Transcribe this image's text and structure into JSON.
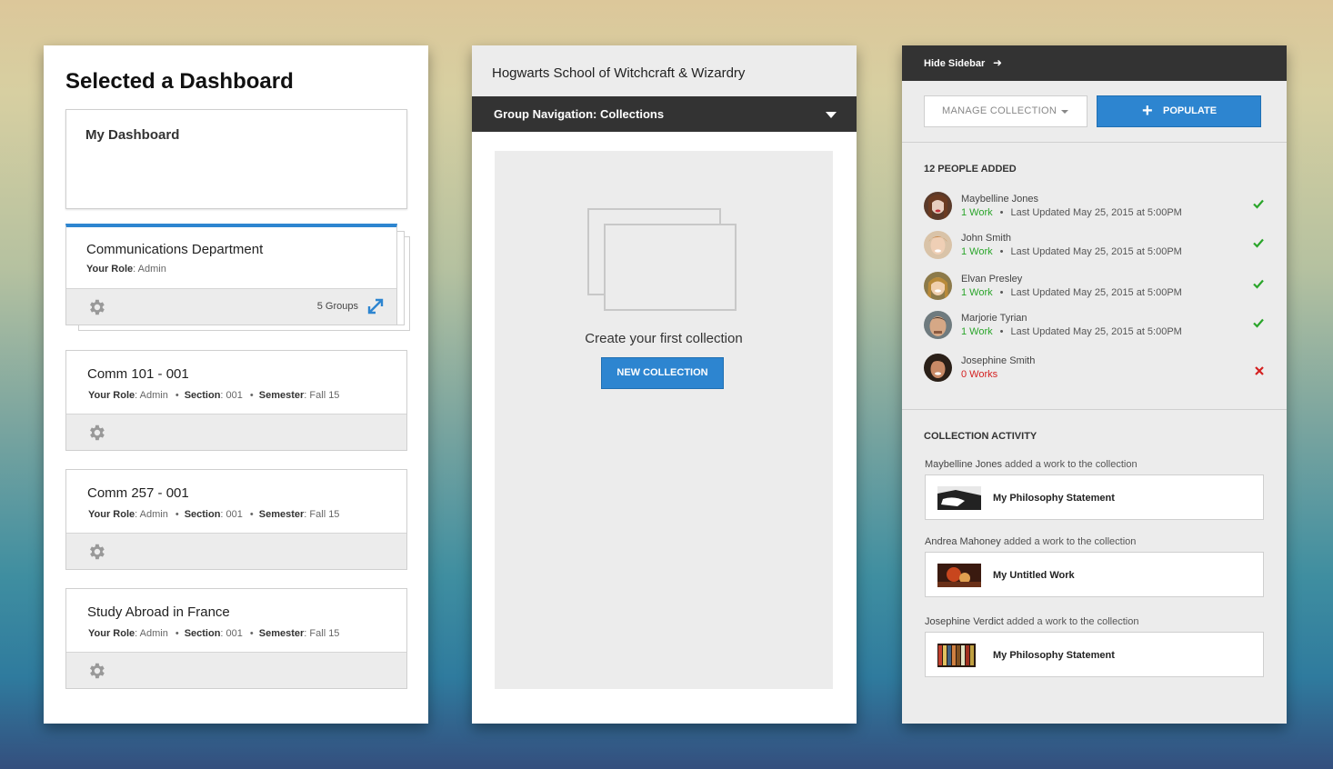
{
  "dashboard_panel": {
    "title": "Selected a Dashboard",
    "my_dashboard": "My Dashboard",
    "featured": {
      "name": "Communications Department",
      "role_label": "Your Role",
      "role_value": ": Admin",
      "groups": "5 Groups"
    },
    "courses": [
      {
        "name": "Comm 101 - 001",
        "role_label": "Your Role",
        "role_value": ": Admin",
        "section_label": "Section",
        "section_value": ": 001",
        "semester_label": "Semester",
        "semester_value": ": Fall 15"
      },
      {
        "name": "Comm 257 - 001",
        "role_label": "Your Role",
        "role_value": ": Admin",
        "section_label": "Section",
        "section_value": ": 001",
        "semester_label": "Semester",
        "semester_value": ": Fall 15"
      },
      {
        "name": "Study Abroad in France",
        "role_label": "Your Role",
        "role_value": ": Admin",
        "section_label": "Section",
        "section_value": ": 001",
        "semester_label": "Semester",
        "semester_value": ": Fall 15"
      }
    ]
  },
  "collections_panel": {
    "school": "Hogwarts School of Witchcraft & Wizardry",
    "group_nav": "Group Navigation: Collections",
    "empty_text": "Create your first collection",
    "new_button": "NEW COLLECTION"
  },
  "sidebar_panel": {
    "hide_sidebar": "Hide Sidebar",
    "hide_arrow": "➜",
    "manage_button": "MANAGE COLLECTION",
    "populate_button": "POPULATE",
    "people_heading": "12 PEOPLE ADDED",
    "people": [
      {
        "name": "Maybelline Jones",
        "works": "1 Work",
        "updated": "Last Updated May 25, 2015 at 5:00PM",
        "status": "check"
      },
      {
        "name": "John Smith",
        "works": "1 Work",
        "updated": "Last Updated May 25, 2015 at 5:00PM",
        "status": "check"
      },
      {
        "name": "Elvan Presley",
        "works": "1 Work",
        "updated": "Last Updated May 25, 2015 at 5:00PM",
        "status": "check"
      },
      {
        "name": "Marjorie Tyrian",
        "works": "1 Work",
        "updated": "Last Updated May 25, 2015 at 5:00PM",
        "status": "check"
      },
      {
        "name": "Josephine Smith",
        "works": "0 Works",
        "updated": "",
        "status": "cross"
      }
    ],
    "activity_heading": "COLLECTION ACTIVITY",
    "activity": [
      {
        "actor": "Maybelline Jones",
        "action": " added a work to the collection",
        "work": "My Philosophy Statement"
      },
      {
        "actor": "Andrea Mahoney",
        "action": " added a work to the collection",
        "work": "My Untitled Work"
      },
      {
        "actor": "Josephine Verdict",
        "action": " added a work to the collection",
        "work": "My Philosophy Statement"
      }
    ]
  },
  "colors": {
    "accent_blue": "#2d85d0",
    "dark_bar": "#333333",
    "success_green": "#2aa52a",
    "error_red": "#d42020"
  }
}
